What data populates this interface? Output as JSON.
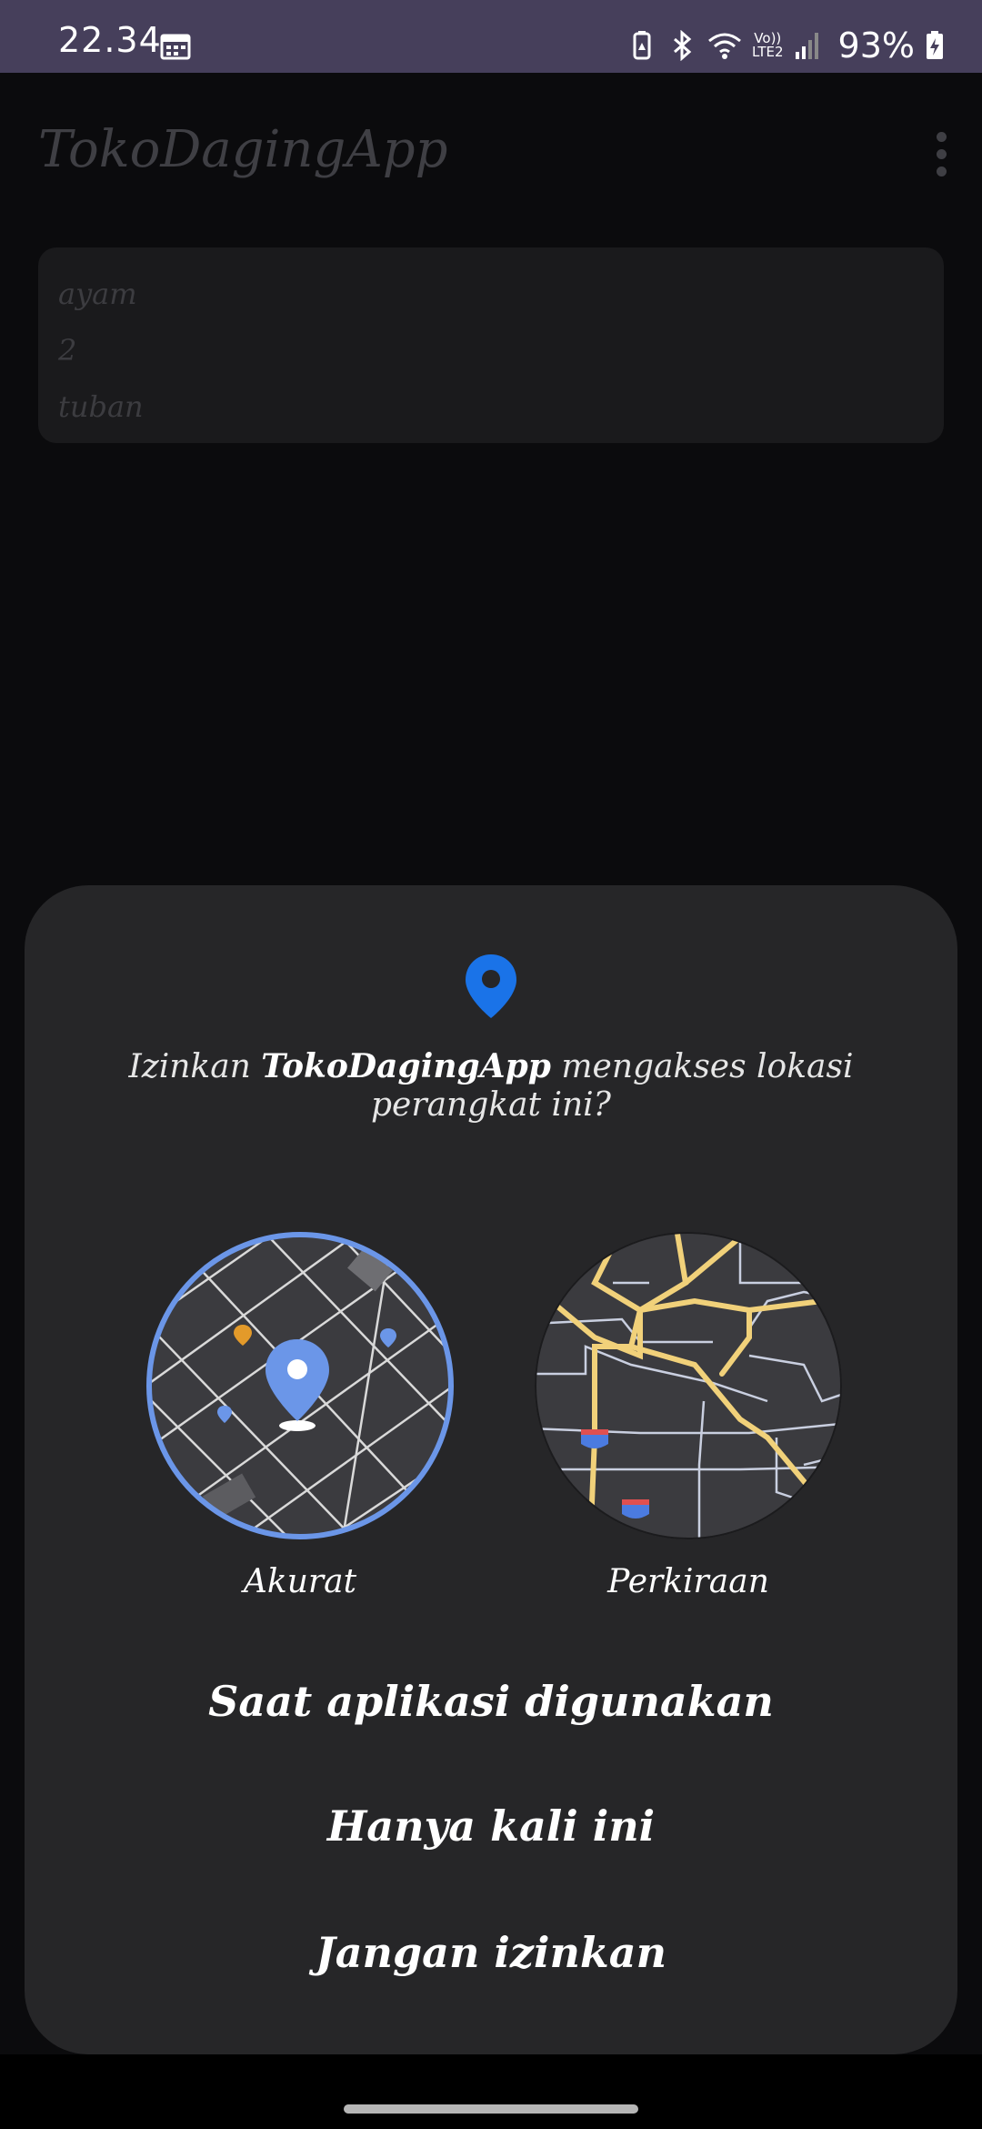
{
  "status_bar": {
    "time": "22.34",
    "network_label_top": "Vo))",
    "network_label_bottom": "LTE2",
    "battery_percent": "93%",
    "icons": [
      "calendar-icon",
      "battery-saver-icon",
      "bluetooth-icon",
      "wifi-icon",
      "signal-icon",
      "battery-charging-icon"
    ]
  },
  "app": {
    "title": "TokoDagingApp",
    "menu_icon": "overflow-menu-icon",
    "card_lines": [
      "ayam",
      "2",
      "tuban"
    ]
  },
  "dialog": {
    "icon": "location-pin-icon",
    "prompt_prefix": "Izinkan ",
    "prompt_app": "TokoDagingApp",
    "prompt_suffix": " mengakses lokasi perangkat ini?",
    "options": [
      {
        "label": "Akurat",
        "selected": true
      },
      {
        "label": "Perkiraan",
        "selected": false
      }
    ],
    "actions": [
      "Saat aplikasi digunakan",
      "Hanya kali ini",
      "Jangan izinkan"
    ]
  },
  "colors": {
    "status_bar": "#463f5b",
    "background": "#0b0b0d",
    "sheet": "#262628",
    "accent_blue": "#1a73e8",
    "map_blue": "#6b96e8",
    "road_yellow": "#f1d17a"
  }
}
